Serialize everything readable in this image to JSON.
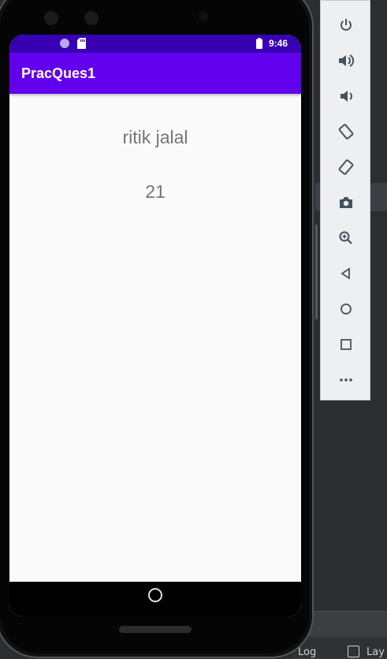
{
  "app": {
    "title": "PracQues1"
  },
  "status_bar": {
    "time": "9:46"
  },
  "content": {
    "name_text": "ritik jalal",
    "number_text": "21"
  },
  "emulator_toolbar": {
    "buttons": [
      {
        "icon": "power-icon",
        "glyph": "⏻"
      },
      {
        "icon": "volume-up-icon",
        "glyph": "🔊"
      },
      {
        "icon": "volume-down-icon",
        "glyph": "🔉"
      },
      {
        "icon": "rotate-left-icon",
        "glyph": "⟲"
      },
      {
        "icon": "rotate-right-icon",
        "glyph": "⟳"
      },
      {
        "icon": "camera-icon",
        "glyph": "📷"
      },
      {
        "icon": "zoom-icon",
        "glyph": "🔍"
      },
      {
        "icon": "back-icon",
        "glyph": "◁"
      },
      {
        "icon": "home-icon",
        "glyph": "○"
      },
      {
        "icon": "overview-icon",
        "glyph": "□"
      },
      {
        "icon": "more-icon",
        "glyph": "•••"
      }
    ]
  },
  "ide": {
    "bottom_items": [
      "Log",
      "Lay"
    ]
  },
  "colors": {
    "status_bar": "#3700b3",
    "app_bar": "#6200ee",
    "screen_bg": "#fafafa",
    "content_text": "#757575"
  }
}
